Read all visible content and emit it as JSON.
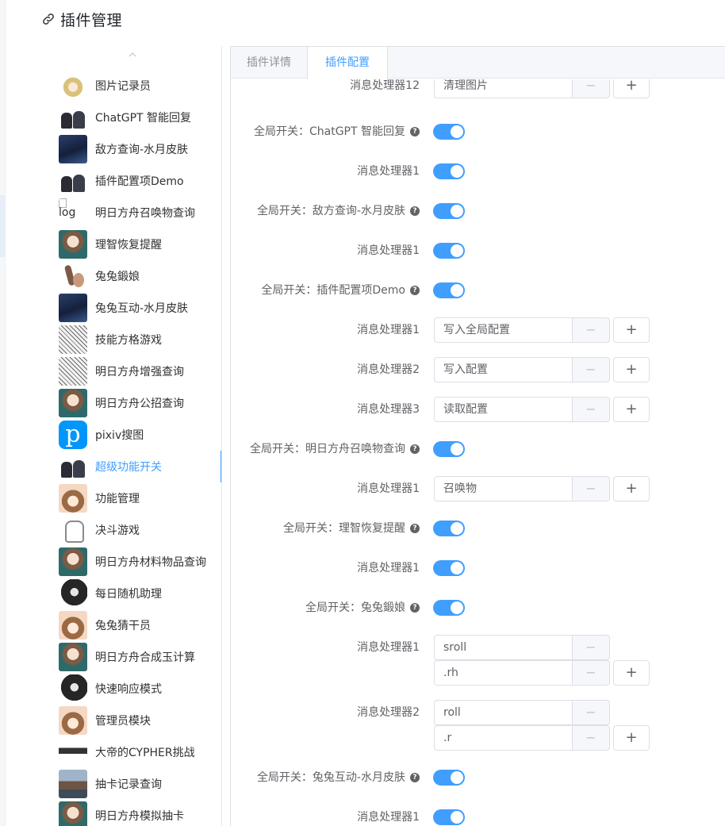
{
  "page": {
    "title": "插件管理"
  },
  "sidebar": {
    "items": [
      {
        "label": "图片记录员",
        "avatar": "blonde-girl-avatar"
      },
      {
        "label": "ChatGPT 智能回复",
        "avatar": "chibi-avatar"
      },
      {
        "label": "敌方查询-水月皮肤",
        "avatar": "dark-blue-avatar"
      },
      {
        "label": "插件配置项Demo",
        "avatar": "chibi-avatar"
      },
      {
        "label": "明日方舟召唤物查询",
        "avatar": "broken-image",
        "alt": "log"
      },
      {
        "label": "理智恢复提醒",
        "avatar": "girl-avatar"
      },
      {
        "label": "兔兔鍛娘",
        "avatar": "bunny-avatar"
      },
      {
        "label": "兔兔互动-水月皮肤",
        "avatar": "dark-blue-avatar"
      },
      {
        "label": "技能方格游戏",
        "avatar": "sketch-avatar"
      },
      {
        "label": "明日方舟增强查询",
        "avatar": "sketch-avatar"
      },
      {
        "label": "明日方舟公招查询",
        "avatar": "girl-avatar"
      },
      {
        "label": "pixiv搜图",
        "avatar": "pixiv-logo",
        "logo_text": "p"
      },
      {
        "label": "超级功能开关",
        "avatar": "chibi-avatar",
        "active": true
      },
      {
        "label": "功能管理",
        "avatar": "brown-girl-avatar"
      },
      {
        "label": "决斗游戏",
        "avatar": "white-character-avatar"
      },
      {
        "label": "明日方舟材料物品查询",
        "avatar": "girl-avatar"
      },
      {
        "label": "每日随机助理",
        "avatar": "black-character-avatar"
      },
      {
        "label": "兔兔猜干员",
        "avatar": "brown-girl-avatar"
      },
      {
        "label": "明日方舟合成玉计算",
        "avatar": "girl-avatar"
      },
      {
        "label": "快速响应模式",
        "avatar": "black-character-avatar"
      },
      {
        "label": "管理员模块",
        "avatar": "brown-girl-avatar"
      },
      {
        "label": "大帝的CYPHER挑战",
        "avatar": "cypher-avatar"
      },
      {
        "label": "抽卡记录查询",
        "avatar": "photo-avatar"
      },
      {
        "label": "明日方舟模拟抽卡",
        "avatar": "girl-avatar"
      }
    ]
  },
  "tabs": [
    {
      "label": "插件详情",
      "active": false
    },
    {
      "label": "插件配置",
      "active": true
    }
  ],
  "form": {
    "rows": [
      {
        "type": "input",
        "label": "消息处理器12",
        "value": "清理图片",
        "has_plus": true
      },
      {
        "type": "switch",
        "label": "全局开关：ChatGPT 智能回复",
        "help": true,
        "on": true
      },
      {
        "type": "switch",
        "label": "消息处理器1",
        "help": false,
        "on": true
      },
      {
        "type": "switch",
        "label": "全局开关：敌方查询-水月皮肤",
        "help": true,
        "on": true
      },
      {
        "type": "switch",
        "label": "消息处理器1",
        "help": false,
        "on": true
      },
      {
        "type": "switch",
        "label": "全局开关：插件配置项Demo",
        "help": true,
        "on": true
      },
      {
        "type": "input",
        "label": "消息处理器1",
        "value": "写入全局配置",
        "has_plus": true
      },
      {
        "type": "input",
        "label": "消息处理器2",
        "value": "写入配置",
        "has_plus": true
      },
      {
        "type": "input",
        "label": "消息处理器3",
        "value": "读取配置",
        "has_plus": true
      },
      {
        "type": "switch",
        "label": "全局开关：明日方舟召唤物查询",
        "help": true,
        "on": true
      },
      {
        "type": "input",
        "label": "消息处理器1",
        "value": "召唤物",
        "has_plus": true
      },
      {
        "type": "switch",
        "label": "全局开关：理智恢复提醒",
        "help": true,
        "on": true
      },
      {
        "type": "switch",
        "label": "消息处理器1",
        "help": false,
        "on": true
      },
      {
        "type": "switch",
        "label": "全局开关：兔兔鍛娘",
        "help": true,
        "on": true
      },
      {
        "type": "multi",
        "label": "消息处理器1",
        "values": [
          "sroll",
          ".rh"
        ]
      },
      {
        "type": "multi",
        "label": "消息处理器2",
        "values": [
          "roll",
          ".r"
        ]
      },
      {
        "type": "switch",
        "label": "全局开关：兔兔互动-水月皮肤",
        "help": true,
        "on": true
      },
      {
        "type": "switch",
        "label": "消息处理器1",
        "help": false,
        "on": true
      }
    ]
  },
  "icons": {
    "minus": "−",
    "plus": "+",
    "help": "?"
  },
  "colors": {
    "accent": "#409eff",
    "text": "#606266",
    "border": "#dcdfe6"
  }
}
